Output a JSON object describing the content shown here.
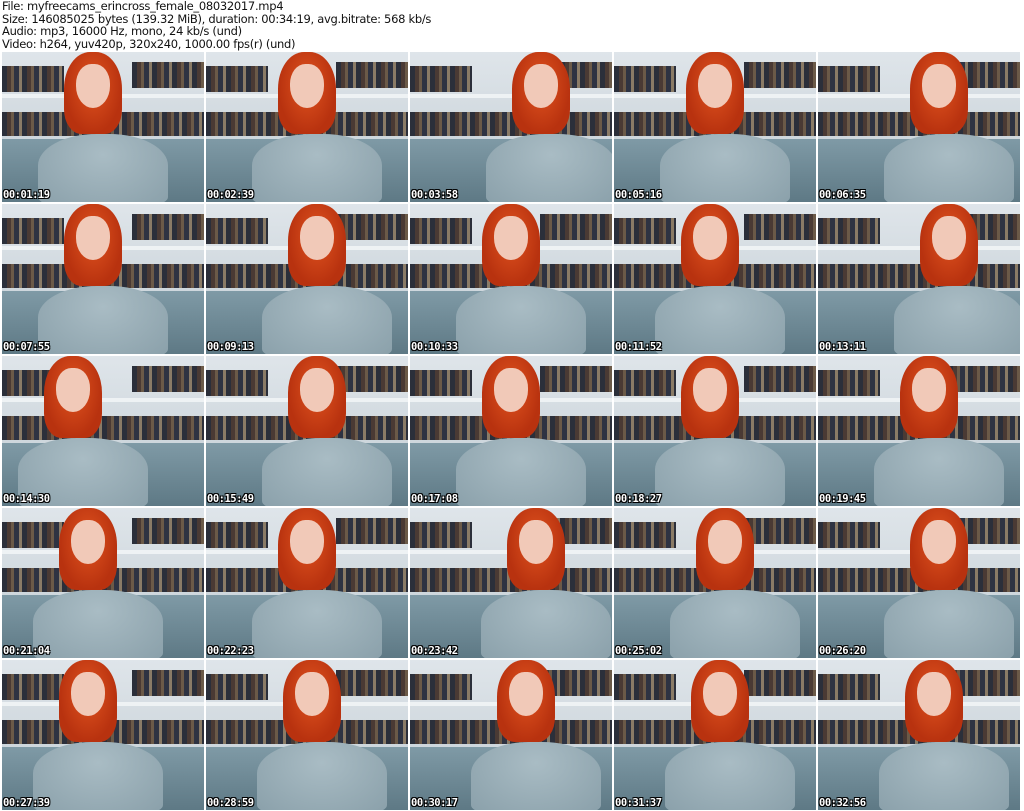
{
  "header": {
    "file": "File: myfreecams_erincross_female_08032017.mp4",
    "size": "Size: 146085025 bytes (139.32 MiB), duration: 00:34:19, avg.bitrate: 568 kb/s",
    "audio": "Audio: mp3, 16000 Hz, mono, 24 kb/s (und)",
    "video": "Video: h264, yuv420p, 320x240, 1000.00 fps(r) (und)"
  },
  "thumbnails": [
    {
      "timestamp": "00:01:19"
    },
    {
      "timestamp": "00:02:39"
    },
    {
      "timestamp": "00:03:58"
    },
    {
      "timestamp": "00:05:16"
    },
    {
      "timestamp": "00:06:35"
    },
    {
      "timestamp": "00:07:55"
    },
    {
      "timestamp": "00:09:13"
    },
    {
      "timestamp": "00:10:33"
    },
    {
      "timestamp": "00:11:52"
    },
    {
      "timestamp": "00:13:11"
    },
    {
      "timestamp": "00:14:30"
    },
    {
      "timestamp": "00:15:49"
    },
    {
      "timestamp": "00:17:08"
    },
    {
      "timestamp": "00:18:27"
    },
    {
      "timestamp": "00:19:45"
    },
    {
      "timestamp": "00:21:04"
    },
    {
      "timestamp": "00:22:23"
    },
    {
      "timestamp": "00:23:42"
    },
    {
      "timestamp": "00:25:02"
    },
    {
      "timestamp": "00:26:20"
    },
    {
      "timestamp": "00:27:39"
    },
    {
      "timestamp": "00:28:59"
    },
    {
      "timestamp": "00:30:17"
    },
    {
      "timestamp": "00:31:37"
    },
    {
      "timestamp": "00:32:56"
    }
  ]
}
